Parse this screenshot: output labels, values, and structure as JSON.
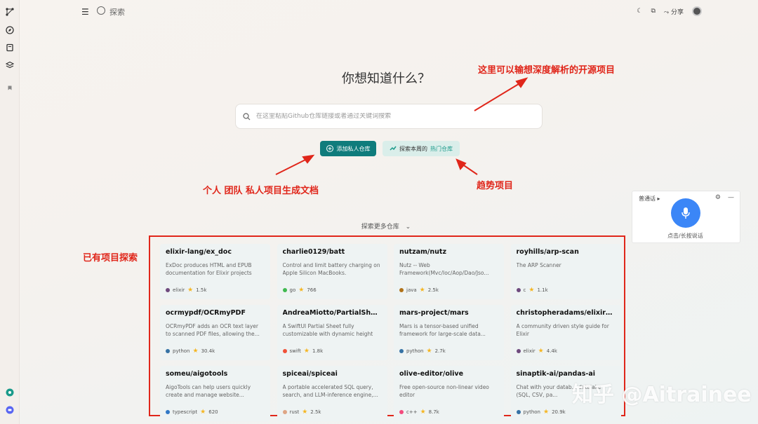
{
  "topbar": {
    "title": "探索",
    "share_label": "分享"
  },
  "main": {
    "heading": "你想知道什么？",
    "search_placeholder": "在这里粘贴Github仓库链接或者通过关键词搜索",
    "add_private_label": "添加私人仓库",
    "hot_prefix": "探索本周的",
    "hot_highlight": "热门仓库",
    "explore_more": "探索更多仓库"
  },
  "annotations": {
    "top_right": "这里可以输想深度解析的开源项目",
    "bottom_left": "个人 团队 私人项目生成文档",
    "trend": "趋势项目",
    "existing": "已有项目探索"
  },
  "repos": [
    {
      "name": "elixir-lang/ex_doc",
      "desc": "ExDoc produces HTML and EPUB documentation for Elixir projects",
      "lang": "elixir",
      "lang_color": "#6e4a7e",
      "stars": "1.5k"
    },
    {
      "name": "charlie0129/batt",
      "desc": "Control and limit battery charging on Apple Silicon MacBooks.",
      "lang": "go",
      "lang_color": "#3fb950",
      "stars": "766"
    },
    {
      "name": "nutzam/nutz",
      "desc": "Nutz -- Web Framework(Mvc/Ioc/Aop/Dao/Jso...",
      "lang": "java",
      "lang_color": "#b07219",
      "stars": "2.5k"
    },
    {
      "name": "royhills/arp-scan",
      "desc": "The ARP Scanner",
      "lang": "c",
      "lang_color": "#6e4a7e",
      "stars": "1.1k"
    },
    {
      "name": "ocrmypdf/OCRmyPDF",
      "desc": "OCRmyPDF adds an OCR text layer to scanned PDF files, allowing the...",
      "lang": "python",
      "lang_color": "#3572a5",
      "stars": "30.4k"
    },
    {
      "name": "AndreaMiotto/PartialSheet",
      "desc": "A SwiftUI Partial Sheet fully customizable with dynamic height",
      "lang": "swift",
      "lang_color": "#f05138",
      "stars": "1.8k"
    },
    {
      "name": "mars-project/mars",
      "desc": "Mars is a tensor-based unified framework for large-scale data...",
      "lang": "python",
      "lang_color": "#3572a5",
      "stars": "2.7k"
    },
    {
      "name": "christopheradams/elixir_sty...",
      "desc": "A community driven style guide for Elixir",
      "lang": "elixir",
      "lang_color": "#6e4a7e",
      "stars": "4.4k"
    },
    {
      "name": "someu/aigotools",
      "desc": "AigoTools can help users quickly create and manage website...",
      "lang": "typescript",
      "lang_color": "#3178c6",
      "stars": "620"
    },
    {
      "name": "spiceai/spiceai",
      "desc": "A portable accelerated SQL query, search, and LLM-inference engine,...",
      "lang": "rust",
      "lang_color": "#dea584",
      "stars": "2.5k"
    },
    {
      "name": "olive-editor/olive",
      "desc": "Free open-source non-linear video editor",
      "lang": "c++",
      "lang_color": "#f34b7d",
      "stars": "8.7k"
    },
    {
      "name": "sinaptik-ai/pandas-ai",
      "desc": "Chat with your datab... datalake (SQL, CSV, pa...",
      "lang": "python",
      "lang_color": "#3572a5",
      "stars": "20.9k"
    }
  ],
  "voice_widget": {
    "lang": "普通话",
    "hint": "点击/长按说话"
  },
  "watermark": "知乎 @Aitrainee",
  "colors": {
    "accent": "#0f7c7c",
    "annotation": "#e0261a",
    "mic": "#3b86f7"
  }
}
